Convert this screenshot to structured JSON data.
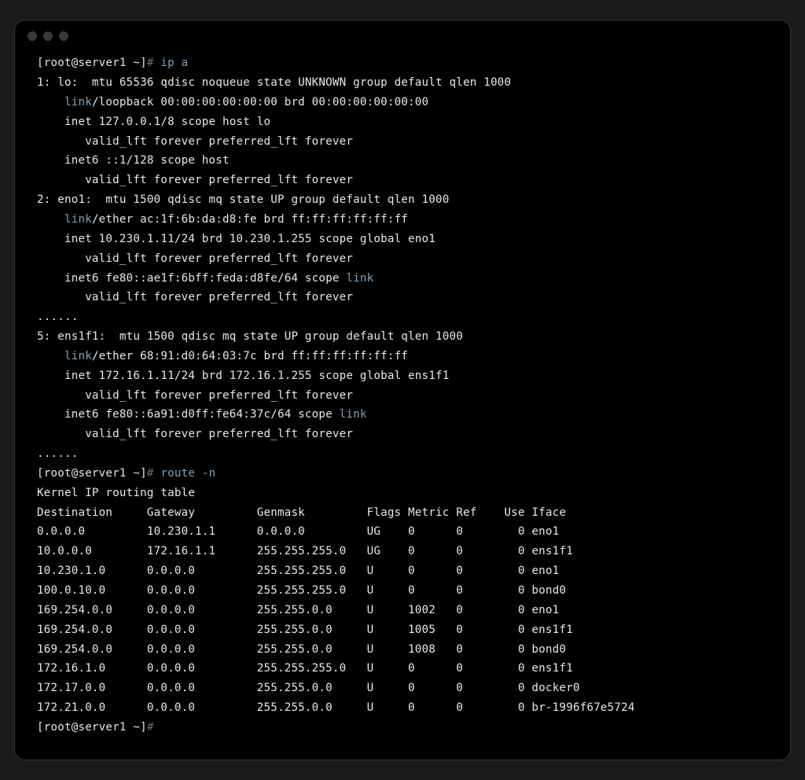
{
  "prompt1": {
    "user": "[root@server1 ~]",
    "sym": "#",
    "cmd": "ip a"
  },
  "ipa": {
    "if1_hdr": "1: lo:  mtu 65536 qdisc noqueue state UNKNOWN group default qlen 1000",
    "if1_link_kw": "link",
    "if1_link_rest": "/loopback 00:00:00:00:00:00 brd 00:00:00:00:00:00",
    "if1_inet": "    inet 127.0.0.1/8 scope host lo",
    "if1_valid1": "       valid_lft forever preferred_lft forever",
    "if1_inet6": "    inet6 ::1/128 scope host",
    "if1_valid2": "       valid_lft forever preferred_lft forever",
    "if2_hdr": "2: eno1:  mtu 1500 qdisc mq state UP group default qlen 1000",
    "if2_link_kw": "link",
    "if2_link_rest": "/ether ac:1f:6b:da:d8:fe brd ff:ff:ff:ff:ff:ff",
    "if2_inet": "    inet 10.230.1.11/24 brd 10.230.1.255 scope global eno1",
    "if2_valid1": "       valid_lft forever preferred_lft forever",
    "if2_inet6_prefix": "    inet6 fe80::ae1f:6bff:feda:d8fe/64 scope ",
    "if2_inet6_linkkw": "link",
    "if2_valid2": "       valid_lft forever preferred_lft forever",
    "dots1": "......",
    "if5_hdr": "5: ens1f1:  mtu 1500 qdisc mq state UP group default qlen 1000",
    "if5_link_kw": "link",
    "if5_link_rest": "/ether 68:91:d0:64:03:7c brd ff:ff:ff:ff:ff:ff",
    "if5_inet": "    inet 172.16.1.11/24 brd 172.16.1.255 scope global ens1f1",
    "if5_valid1": "       valid_lft forever preferred_lft forever",
    "if5_inet6_prefix": "    inet6 fe80::6a91:d0ff:fe64:37c/64 scope ",
    "if5_inet6_linkkw": "link",
    "if5_valid2": "       valid_lft forever preferred_lft forever",
    "dots2": "......"
  },
  "prompt2": {
    "user": "[root@server1 ~]",
    "sym": "#",
    "cmd": "route -n"
  },
  "route": {
    "title": "Kernel IP routing table",
    "hdr": "Destination     Gateway         Genmask         Flags Metric Ref    Use Iface",
    "r0": "0.0.0.0         10.230.1.1      0.0.0.0         UG    0      0        0 eno1",
    "r1": "10.0.0.0        172.16.1.1      255.255.255.0   UG    0      0        0 ens1f1",
    "r2": "10.230.1.0      0.0.0.0         255.255.255.0   U     0      0        0 eno1",
    "r3": "100.0.10.0      0.0.0.0         255.255.255.0   U     0      0        0 bond0",
    "r4": "169.254.0.0     0.0.0.0         255.255.0.0     U     1002   0        0 eno1",
    "r5": "169.254.0.0     0.0.0.0         255.255.0.0     U     1005   0        0 ens1f1",
    "r6": "169.254.0.0     0.0.0.0         255.255.0.0     U     1008   0        0 bond0",
    "r7": "172.16.1.0      0.0.0.0         255.255.255.0   U     0      0        0 ens1f1",
    "r8": "172.17.0.0      0.0.0.0         255.255.0.0     U     0      0        0 docker0",
    "r9": "172.21.0.0      0.0.0.0         255.255.0.0     U     0      0        0 br-1996f67e5724"
  },
  "prompt3": {
    "user": "[root@server1 ~]",
    "sym": "#"
  }
}
